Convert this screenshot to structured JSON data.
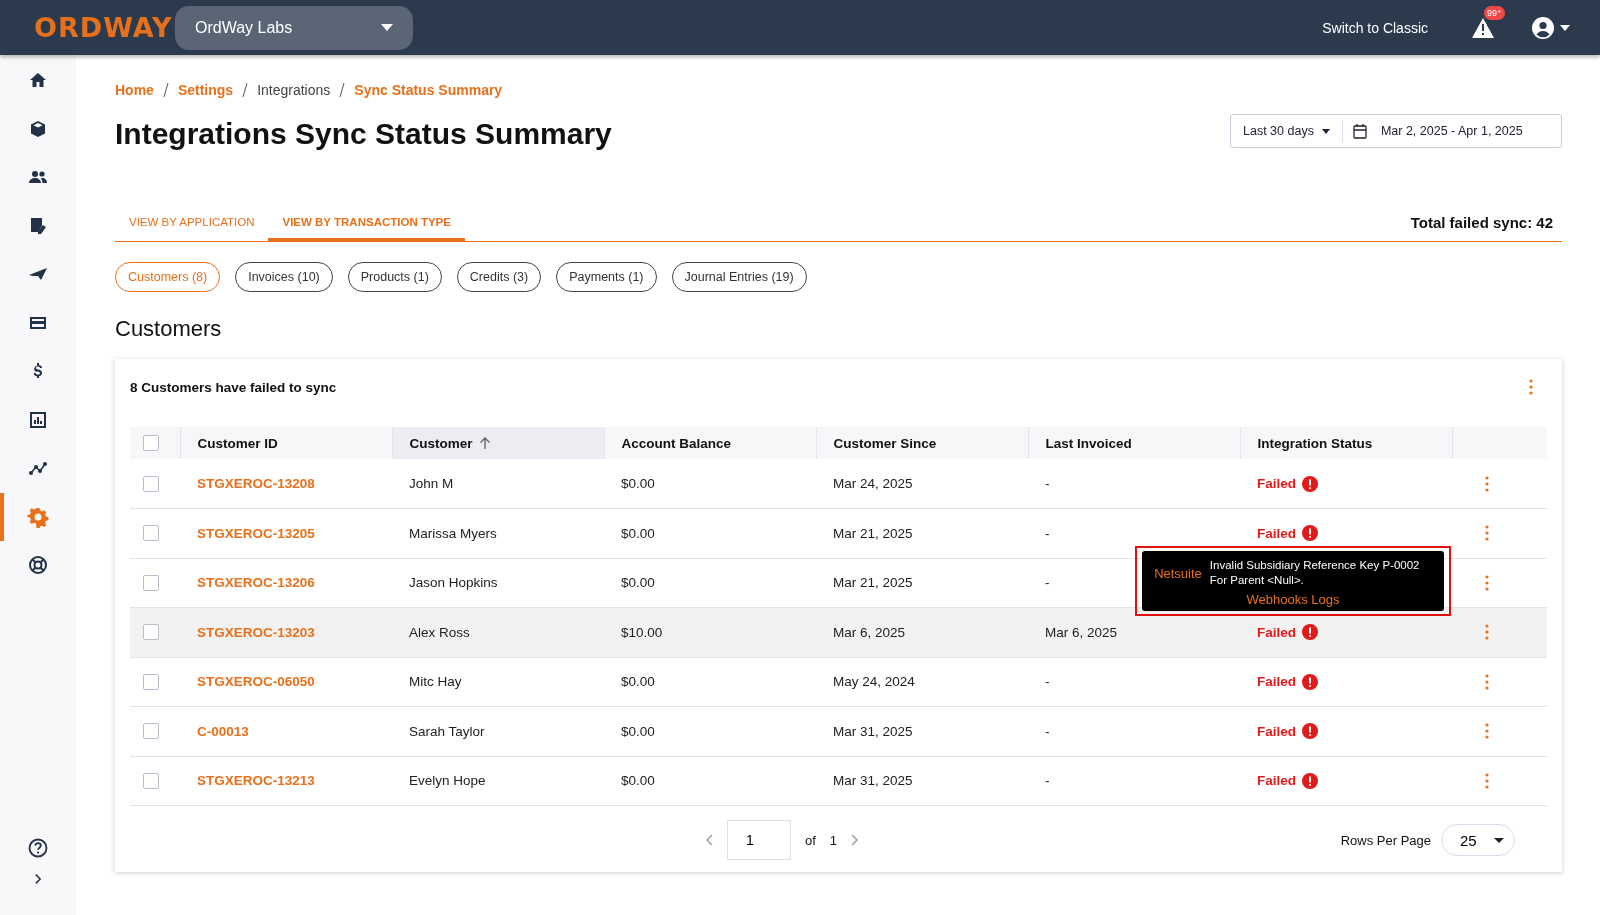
{
  "topbar": {
    "logo": "ORDWAY",
    "org_select": "OrdWay Labs",
    "switch_link": "Switch to Classic",
    "alert_badge": "99⁺"
  },
  "sidebar": {
    "items": [
      {
        "kind": "home",
        "selected": false
      },
      {
        "kind": "cube",
        "selected": false
      },
      {
        "kind": "people",
        "selected": false
      },
      {
        "kind": "doc",
        "selected": false
      },
      {
        "kind": "plane",
        "selected": false
      },
      {
        "kind": "card",
        "selected": false
      },
      {
        "kind": "dollar",
        "selected": false
      },
      {
        "kind": "chart",
        "selected": false
      },
      {
        "kind": "trend",
        "selected": false
      },
      {
        "kind": "gear",
        "selected": true
      },
      {
        "kind": "lifebuoy",
        "selected": false
      }
    ],
    "bottom": [
      {
        "kind": "help"
      },
      {
        "kind": "chevron"
      }
    ]
  },
  "breadcrumb": [
    {
      "label": "Home",
      "kind": "link"
    },
    {
      "label": "Settings",
      "kind": "link"
    },
    {
      "label": "Integrations",
      "kind": "text"
    },
    {
      "label": "Sync Status Summary",
      "kind": "link"
    }
  ],
  "title": "Integrations Sync Status Summary",
  "date_range": {
    "preset": "Last 30 days",
    "range": "Mar 2, 2025 - Apr 1, 2025"
  },
  "tabs": [
    {
      "label": "VIEW BY APPLICATION",
      "selected": false
    },
    {
      "label": "VIEW BY TRANSACTION TYPE",
      "selected": true
    }
  ],
  "total_failed": "Total failed sync: 42",
  "chips": [
    {
      "label": "Customers (8)",
      "selected": true
    },
    {
      "label": "Invoices (10)",
      "selected": false
    },
    {
      "label": "Products (1)",
      "selected": false
    },
    {
      "label": "Credits (3)",
      "selected": false
    },
    {
      "label": "Payments (1)",
      "selected": false
    },
    {
      "label": "Journal Entries (19)",
      "selected": false
    }
  ],
  "section_title": "Customers",
  "table": {
    "caption": "8 Customers have failed to sync",
    "header_checked": false,
    "columns": [
      {
        "label": "Customer ID",
        "sorted": false
      },
      {
        "label": "Customer",
        "sorted": true
      },
      {
        "label": "Account Balance",
        "sorted": false
      },
      {
        "label": "Customer Since",
        "sorted": false
      },
      {
        "label": "Last Invoiced",
        "sorted": false
      },
      {
        "label": "Integration Status",
        "sorted": false
      }
    ],
    "rows": [
      {
        "checked": false,
        "highlighted": false,
        "id": "STGXEROC-13208",
        "customer": "John M",
        "balance": "$0.00",
        "since": "Mar 24, 2025",
        "last_invoiced": "-",
        "status": "Failed"
      },
      {
        "checked": false,
        "highlighted": false,
        "id": "STGXEROC-13205",
        "customer": "Marissa Myers",
        "balance": "$0.00",
        "since": "Mar 21, 2025",
        "last_invoiced": "-",
        "status": "Failed"
      },
      {
        "checked": false,
        "highlighted": false,
        "id": "STGXEROC-13206",
        "customer": "Jason Hopkins",
        "balance": "$0.00",
        "since": "Mar 21, 2025",
        "last_invoiced": "-"
      },
      {
        "checked": false,
        "highlighted": true,
        "id": "STGXEROC-13203",
        "customer": "Alex Ross",
        "balance": "$10.00",
        "since": "Mar 6, 2025",
        "last_invoiced": "Mar 6, 2025",
        "status": "Failed",
        "tooltip": {
          "source": "Netsuite",
          "message": "Invalid Subsidiary Reference Key P-0002 For Parent <Null>.",
          "link": "Webhooks Logs"
        }
      },
      {
        "checked": false,
        "highlighted": false,
        "id": "STGXEROC-06050",
        "customer": "Mitc Hay",
        "balance": "$0.00",
        "since": "May 24, 2024",
        "last_invoiced": "-",
        "status": "Failed"
      },
      {
        "checked": false,
        "highlighted": false,
        "id": "C-00013",
        "customer": "Sarah Taylor",
        "balance": "$0.00",
        "since": "Mar 31, 2025",
        "last_invoiced": "-",
        "status": "Failed"
      },
      {
        "checked": false,
        "highlighted": false,
        "id": "STGXEROC-13213",
        "customer": "Evelyn Hope",
        "balance": "$0.00",
        "since": "Mar 31, 2025",
        "last_invoiced": "-",
        "status": "Failed"
      }
    ]
  },
  "pagination": {
    "page": "1",
    "of_label": "of",
    "total_pages": "1",
    "rows_label": "Rows Per Page",
    "rows_per_page": "25"
  }
}
